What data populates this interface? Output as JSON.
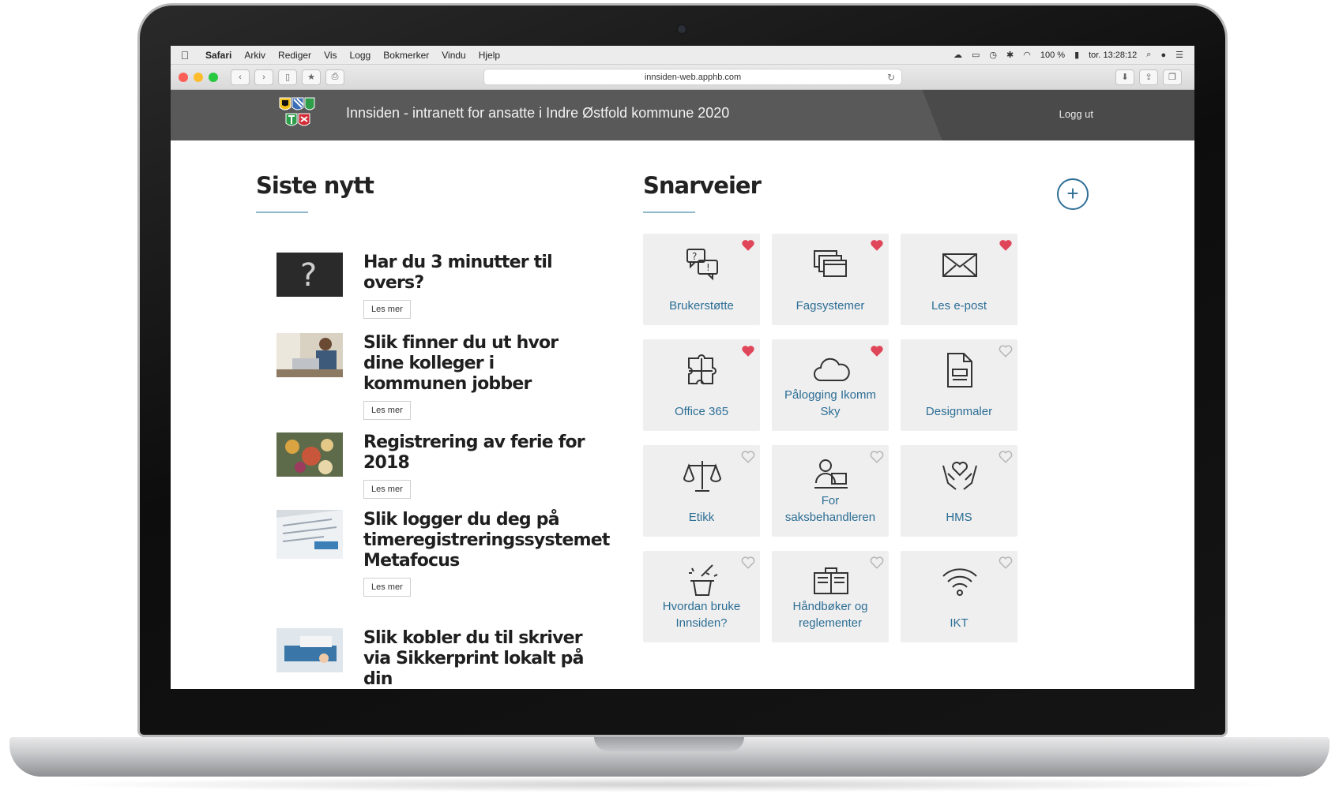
{
  "menubar": {
    "items": [
      "Safari",
      "Arkiv",
      "Rediger",
      "Vis",
      "Logg",
      "Bokmerker",
      "Vindu",
      "Hjelp"
    ],
    "battery": "100 %",
    "clock": "tor. 13:28:12"
  },
  "browser": {
    "url": "innsiden-web.apphb.com"
  },
  "site": {
    "title": "Innsiden - intranett for ansatte i Indre Østfold kommune 2020",
    "logout_label": "Logg ut"
  },
  "news": {
    "heading": "Siste nytt",
    "read_more": "Les mer",
    "items": [
      {
        "title": "Har du 3 minutter til overs?"
      },
      {
        "title": "Slik finner du ut hvor dine kolleger i kommunen jobber"
      },
      {
        "title": "Registrering av ferie for 2018"
      },
      {
        "title": "Slik logger du deg på timeregistreringssystemet Metafocus"
      },
      {
        "title": "Slik kobler du til skriver via Sikkerprint lokalt på din"
      }
    ]
  },
  "shortcuts": {
    "heading": "Snarveier",
    "add_label": "+",
    "items": [
      {
        "label": "Brukerstøtte",
        "icon": "support-chat-icon",
        "favorite": true
      },
      {
        "label": "Fagsystemer",
        "icon": "windows-stack-icon",
        "favorite": true
      },
      {
        "label": "Les e-post",
        "icon": "envelope-icon",
        "favorite": true
      },
      {
        "label": "Office 365",
        "icon": "puzzle-icon",
        "favorite": true
      },
      {
        "label": "Pålogging Ikomm Sky",
        "icon": "cloud-icon",
        "favorite": true
      },
      {
        "label": "Designmaler",
        "icon": "document-icon",
        "favorite": false
      },
      {
        "label": "Etikk",
        "icon": "scales-icon",
        "favorite": false
      },
      {
        "label": "For saksbehandleren",
        "icon": "caseworker-icon",
        "favorite": false
      },
      {
        "label": "HMS",
        "icon": "hands-heart-icon",
        "favorite": false
      },
      {
        "label": "Hvordan bruke Innsiden?",
        "icon": "magic-hat-icon",
        "favorite": false
      },
      {
        "label": "Håndbøker og reglementer",
        "icon": "handbook-icon",
        "favorite": false
      },
      {
        "label": "IKT",
        "icon": "wifi-icon",
        "favorite": false
      }
    ]
  },
  "colors": {
    "accent": "#2c6e95",
    "heart_active": "#e0465a",
    "heart_inactive": "#b5b5b5",
    "header": "#595959"
  }
}
